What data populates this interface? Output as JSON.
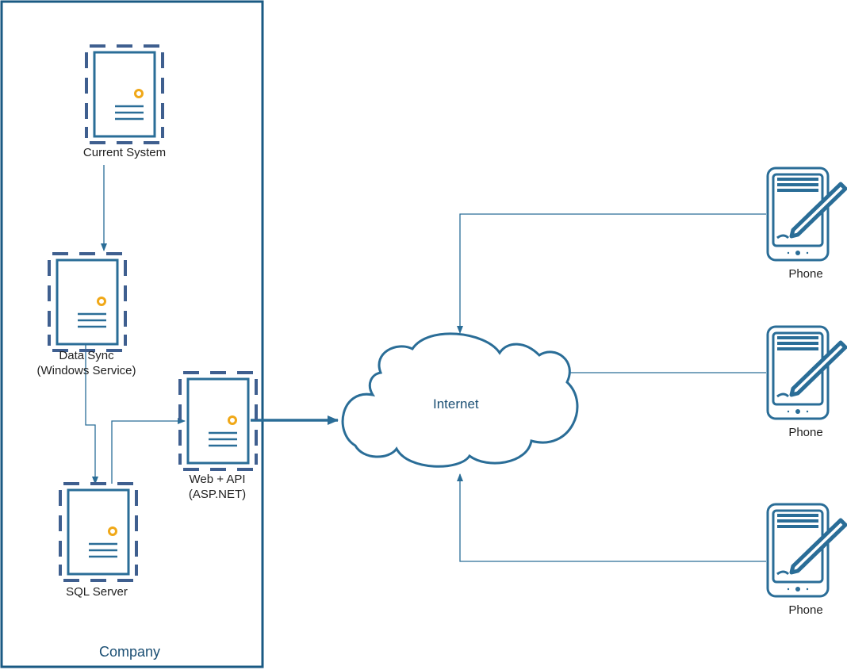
{
  "diagram": {
    "company_label": "Company",
    "internet_label": "Internet",
    "nodes": {
      "current_system": {
        "label": "Current System",
        "icon": "server-icon"
      },
      "data_sync": {
        "label_line1": "Data Sync",
        "label_line2": "(Windows Service)",
        "icon": "server-icon"
      },
      "sql_server": {
        "label": "SQL Server",
        "icon": "server-icon"
      },
      "web_api": {
        "label_line1": "Web + API",
        "label_line2": "(ASP.NET)",
        "icon": "server-icon"
      },
      "phone_1": {
        "label": "Phone",
        "icon": "phone-icon"
      },
      "phone_2": {
        "label": "Phone",
        "icon": "phone-icon"
      },
      "phone_3": {
        "label": "Phone",
        "icon": "phone-icon"
      }
    },
    "colors": {
      "stroke": "#2a6d97",
      "frame": "#1a5a83",
      "dashes": "#3f5f8f",
      "accent": "#f0a818",
      "text": "#1f1f1f"
    }
  }
}
